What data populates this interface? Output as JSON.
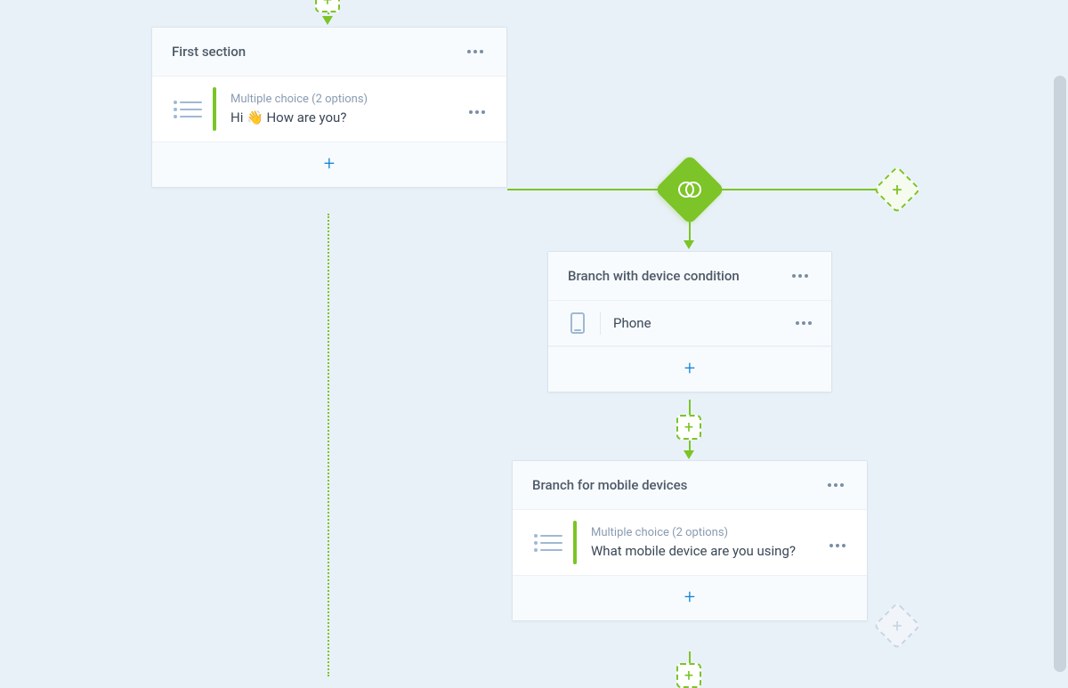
{
  "cards": {
    "first_section": {
      "title": "First section",
      "question": {
        "type_label": "Multiple choice (2 options)",
        "text_before": "Hi ",
        "text_after": " How are you?",
        "emoji": "👋"
      }
    },
    "branch_device": {
      "title": "Branch with device condition",
      "condition_value": "Phone"
    },
    "branch_mobile": {
      "title": "Branch for mobile devices",
      "question": {
        "type_label": "Multiple choice (2 options)",
        "text": "What mobile device are you using?"
      }
    }
  },
  "colors": {
    "accent_green": "#7cc427",
    "accent_blue": "#0a7fd6",
    "bg": "#e9f1f8"
  }
}
